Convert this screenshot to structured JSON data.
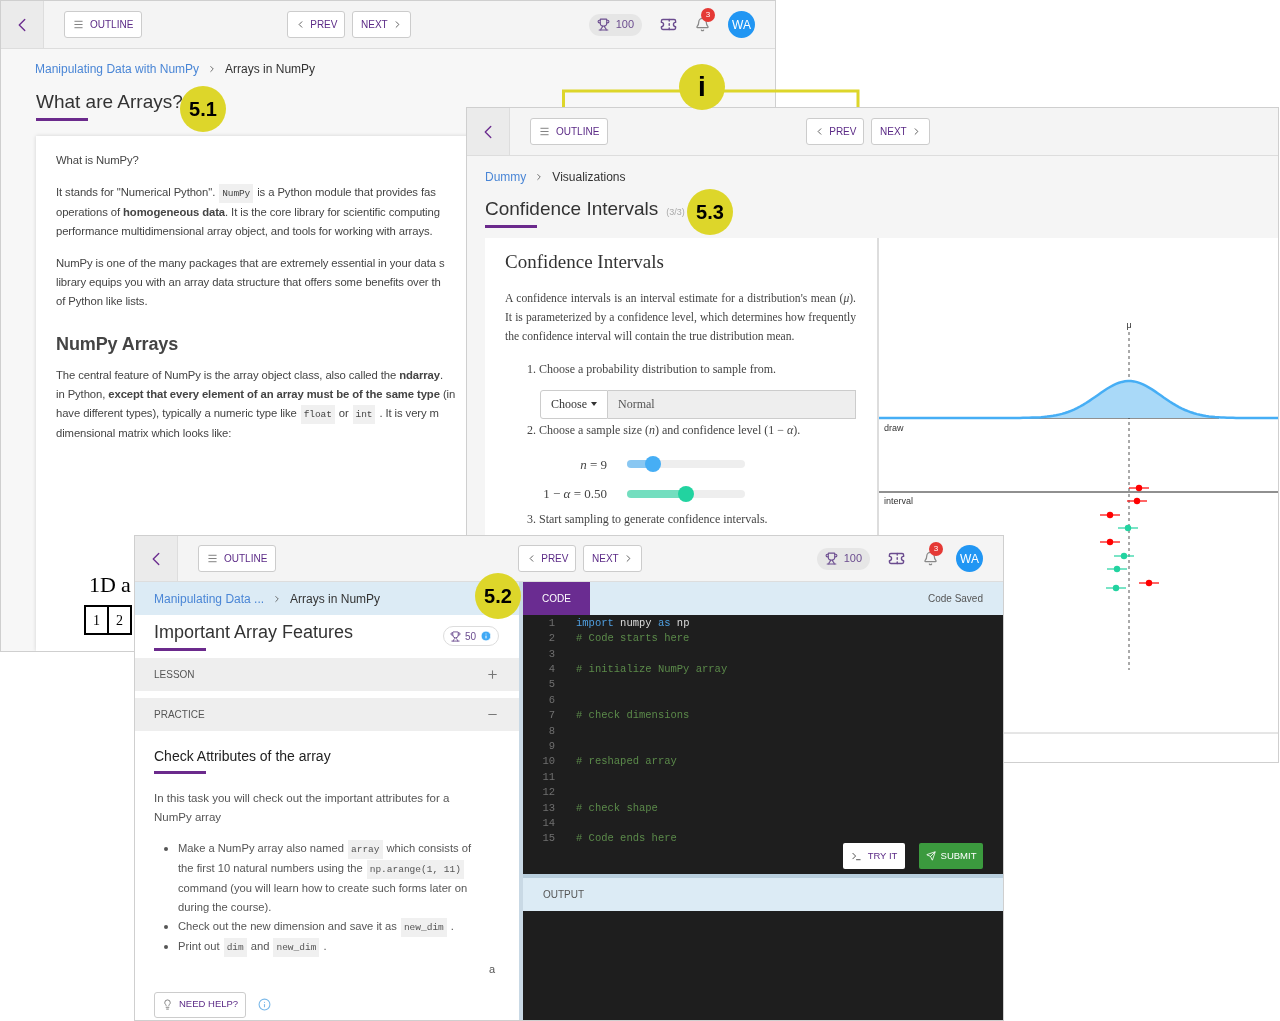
{
  "lesson_window": {
    "header": {
      "outline": "OUTLINE",
      "prev": "PREV",
      "next": "NEXT",
      "points": "100",
      "notifications": "3",
      "avatar": "WA"
    },
    "breadcrumb": [
      "Manipulating Data with NumPy",
      "Arrays in NumPy"
    ],
    "title": "What are Arrays?",
    "content": {
      "heading": "What is NumPy?",
      "paragraphs": [
        [
          [
            {
              "kind": "text",
              "text": "It stands for \"Numerical Python\"."
            },
            {
              "kind": "code",
              "text": "NumPy"
            },
            {
              "kind": "text",
              "text": "is a Python module that provides fas"
            }
          ],
          [
            {
              "kind": "text",
              "text": "operations of **homogeneous data**. It is the core library for scientific computing"
            }
          ],
          [
            {
              "kind": "text",
              "text": "performance multidimensional array object, and tools for working with arrays."
            }
          ]
        ],
        [
          [
            {
              "kind": "text",
              "text": "NumPy is one of the many packages that are extremely essential in your data s"
            }
          ],
          [
            {
              "kind": "text",
              "text": "library equips you with an array data structure that offers some benefits over th"
            }
          ],
          [
            {
              "kind": "text",
              "text": "of Python like lists."
            }
          ]
        ]
      ],
      "section_title": "NumPy Arrays",
      "section_paragraph": [
        [
          {
            "kind": "text",
            "text": "The central feature of NumPy is the array object class, also called the **ndarray**."
          }
        ],
        [
          {
            "kind": "text",
            "text": "in Python, **except that every element of an array must be of the same type** (in"
          }
        ],
        [
          {
            "kind": "text",
            "text": "have different types), typically a numeric type like"
          },
          {
            "kind": "code",
            "text": "float"
          },
          {
            "kind": "text",
            "text": "or"
          },
          {
            "kind": "code",
            "text": "int"
          },
          {
            "kind": "text",
            "text": ". It is very m"
          }
        ],
        [
          {
            "kind": "text",
            "text": "dimensional matrix which looks like:"
          }
        ]
      ],
      "figure_caption": "1D a",
      "array_cells": [
        "1",
        "2"
      ]
    }
  },
  "visualization_window": {
    "header": {
      "outline": "OUTLINE",
      "prev": "PREV",
      "next": "NEXT"
    },
    "breadcrumb": [
      "Dummy",
      "Visualizations"
    ],
    "title": "Confidence Intervals",
    "progress": "(3/3)",
    "panel": {
      "title": "Confidence Intervals",
      "intro": "A confidence intervals is an interval estimate for a distribution's mean (*μ*). It is parameterized by a confidence level, which determines how frequently the confidence interval will contain the true distribution mean.",
      "step_1": "1. Choose a probability distribution to sample from.",
      "dropdown": {
        "button": "Choose",
        "value": "Normal"
      },
      "step_2": "2. Choose a sample size (*n*) and confidence level (1 − *α*).",
      "sliders": [
        {
          "label": "*n* = 9",
          "level": 0.22,
          "color": "#46aef5"
        },
        {
          "label": "1 − *α* = 0.50",
          "level": 0.5,
          "color": "#22d3a0"
        }
      ],
      "step_3": "3. Start sampling to generate confidence intervals."
    },
    "chart": {
      "mean_label": "μ",
      "draw_label": "draw",
      "interval_label": "interval",
      "intervals": [
        {
          "color": "#ff0000"
        },
        {
          "color": "#ff0000"
        },
        {
          "color": "#ff0000"
        },
        {
          "color": "#22d3a0"
        },
        {
          "color": "#ff0000"
        },
        {
          "color": "#22d3a0"
        },
        {
          "color": "#22d3a0"
        },
        {
          "color": "#ff0000"
        },
        {
          "color": "#22d3a0"
        }
      ]
    }
  },
  "practice_window": {
    "header": {
      "outline": "OUTLINE",
      "prev": "PREV",
      "next": "NEXT",
      "points": "100",
      "notifications": "3",
      "avatar": "WA"
    },
    "breadcrumb": [
      "Manipulating Data ...",
      "Arrays in NumPy"
    ],
    "title": "Important Array Features",
    "points_badge": "50",
    "sections": [
      {
        "label": "LESSON",
        "expanded": false
      },
      {
        "label": "PRACTICE",
        "expanded": true
      }
    ],
    "task_title": "Check Attributes of the array",
    "task_intro": "In this task you will check out the important attributes for a NumPy array",
    "bullets": [
      [
        [
          {
            "kind": "text",
            "text": "Make a NumPy array also named"
          },
          {
            "kind": "code",
            "text": "array"
          },
          {
            "kind": "text",
            "text": "which consists of"
          }
        ],
        [
          {
            "kind": "text",
            "text": "the first 10 natural numbers using the"
          },
          {
            "kind": "code",
            "text": "np.arange(1, 11)"
          }
        ],
        [
          {
            "kind": "text",
            "text": "command (you will learn how to create such forms later on"
          }
        ],
        [
          {
            "kind": "text",
            "text": "during the course)."
          }
        ]
      ],
      [
        [
          {
            "kind": "text",
            "text": "Check out the new dimension and save it as"
          },
          {
            "kind": "code",
            "text": "new_dim"
          },
          {
            "kind": "text",
            "text": "."
          }
        ]
      ],
      [
        [
          {
            "kind": "text",
            "text": "Print out"
          },
          {
            "kind": "code",
            "text": "dim"
          },
          {
            "kind": "text",
            "text": "and"
          },
          {
            "kind": "code",
            "text": "new_dim"
          },
          {
            "kind": "text",
            "text": "."
          }
        ]
      ]
    ],
    "stray_text": "a",
    "need_help": "NEED HELP?",
    "code_tab": {
      "label": "CODE",
      "selected": true
    },
    "code_status": "Code Saved",
    "code_lines": [
      {
        "number": "1",
        "tokens": [
          {
            "kind": "keyword",
            "text": "import"
          },
          {
            "kind": "plain",
            "text": " numpy "
          },
          {
            "kind": "keyword",
            "text": "as"
          },
          {
            "kind": "plain",
            "text": " np"
          }
        ]
      },
      {
        "number": "2",
        "tokens": [
          {
            "kind": "comment",
            "text": "# Code starts here"
          }
        ]
      },
      {
        "number": "3"
      },
      {
        "number": "4",
        "tokens": [
          {
            "kind": "comment",
            "text": "# initialize NumPy array"
          }
        ]
      },
      {
        "number": "5"
      },
      {
        "number": "6"
      },
      {
        "number": "7",
        "tokens": [
          {
            "kind": "comment",
            "text": "# check dimensions"
          }
        ]
      },
      {
        "number": "8"
      },
      {
        "number": "9"
      },
      {
        "number": "10",
        "tokens": [
          {
            "kind": "comment",
            "text": "# reshaped array"
          }
        ]
      },
      {
        "number": "11"
      },
      {
        "number": "12"
      },
      {
        "number": "13",
        "tokens": [
          {
            "kind": "comment",
            "text": "# check shape"
          }
        ]
      },
      {
        "number": "14"
      },
      {
        "number": "15",
        "tokens": [
          {
            "kind": "comment",
            "text": "# Code ends here"
          }
        ]
      }
    ],
    "try_it": "TRY IT",
    "submit": "SUBMIT",
    "output_label": "OUTPUT"
  },
  "callouts": [
    "5.1",
    "5.3",
    "5.2",
    "i"
  ]
}
